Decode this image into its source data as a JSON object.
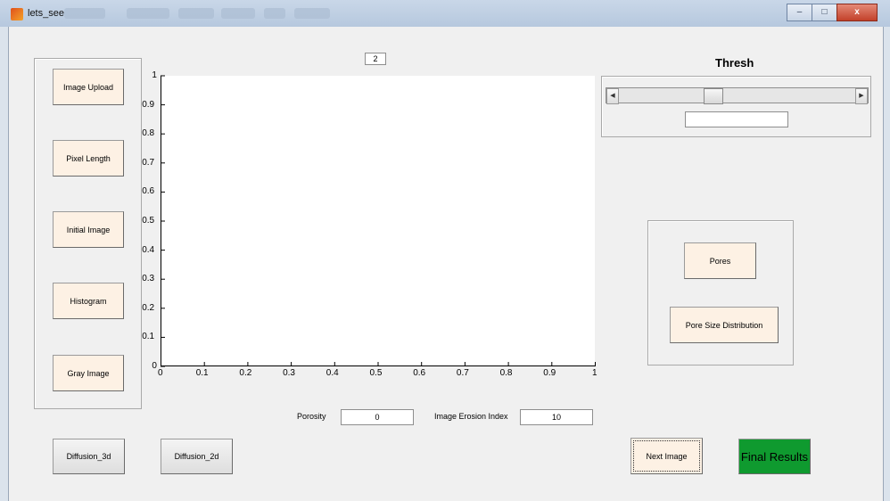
{
  "window": {
    "title": "lets_see",
    "controls": {
      "minimize": "–",
      "maximize": "□",
      "close": "x"
    }
  },
  "left_panel": {
    "buttons": [
      "Image Upload",
      "Pixel Length",
      "Initial Image",
      "Histogram",
      "Gray Image"
    ]
  },
  "axes": {
    "index_box": "2",
    "x_ticks": [
      "0",
      "0.1",
      "0.2",
      "0.3",
      "0.4",
      "0.5",
      "0.6",
      "0.7",
      "0.8",
      "0.9",
      "1"
    ],
    "y_ticks": [
      "0",
      "0.1",
      "0.2",
      "0.3",
      "0.4",
      "0.5",
      "0.6",
      "0.7",
      "0.8",
      "0.9",
      "1"
    ]
  },
  "thresh": {
    "title": "Thresh",
    "slider_value": 0.39,
    "edit_value": ""
  },
  "right_panel": {
    "pores_label": "Pores",
    "psd_label": "Pore Size Distribution"
  },
  "bottom": {
    "porosity_label": "Porosity",
    "porosity_value": "0",
    "erosion_label": "Image Erosion Index",
    "erosion_value": "10",
    "diffusion3d_label": "Diffusion_3d",
    "diffusion2d_label": "Diffusion_2d",
    "next_image_label": "Next Image",
    "final_results_label": "Final Results"
  },
  "colors": {
    "cream_button": "#fdf1e4",
    "final_results_green": "#0f9a2f",
    "background": "#f0f0f0"
  }
}
